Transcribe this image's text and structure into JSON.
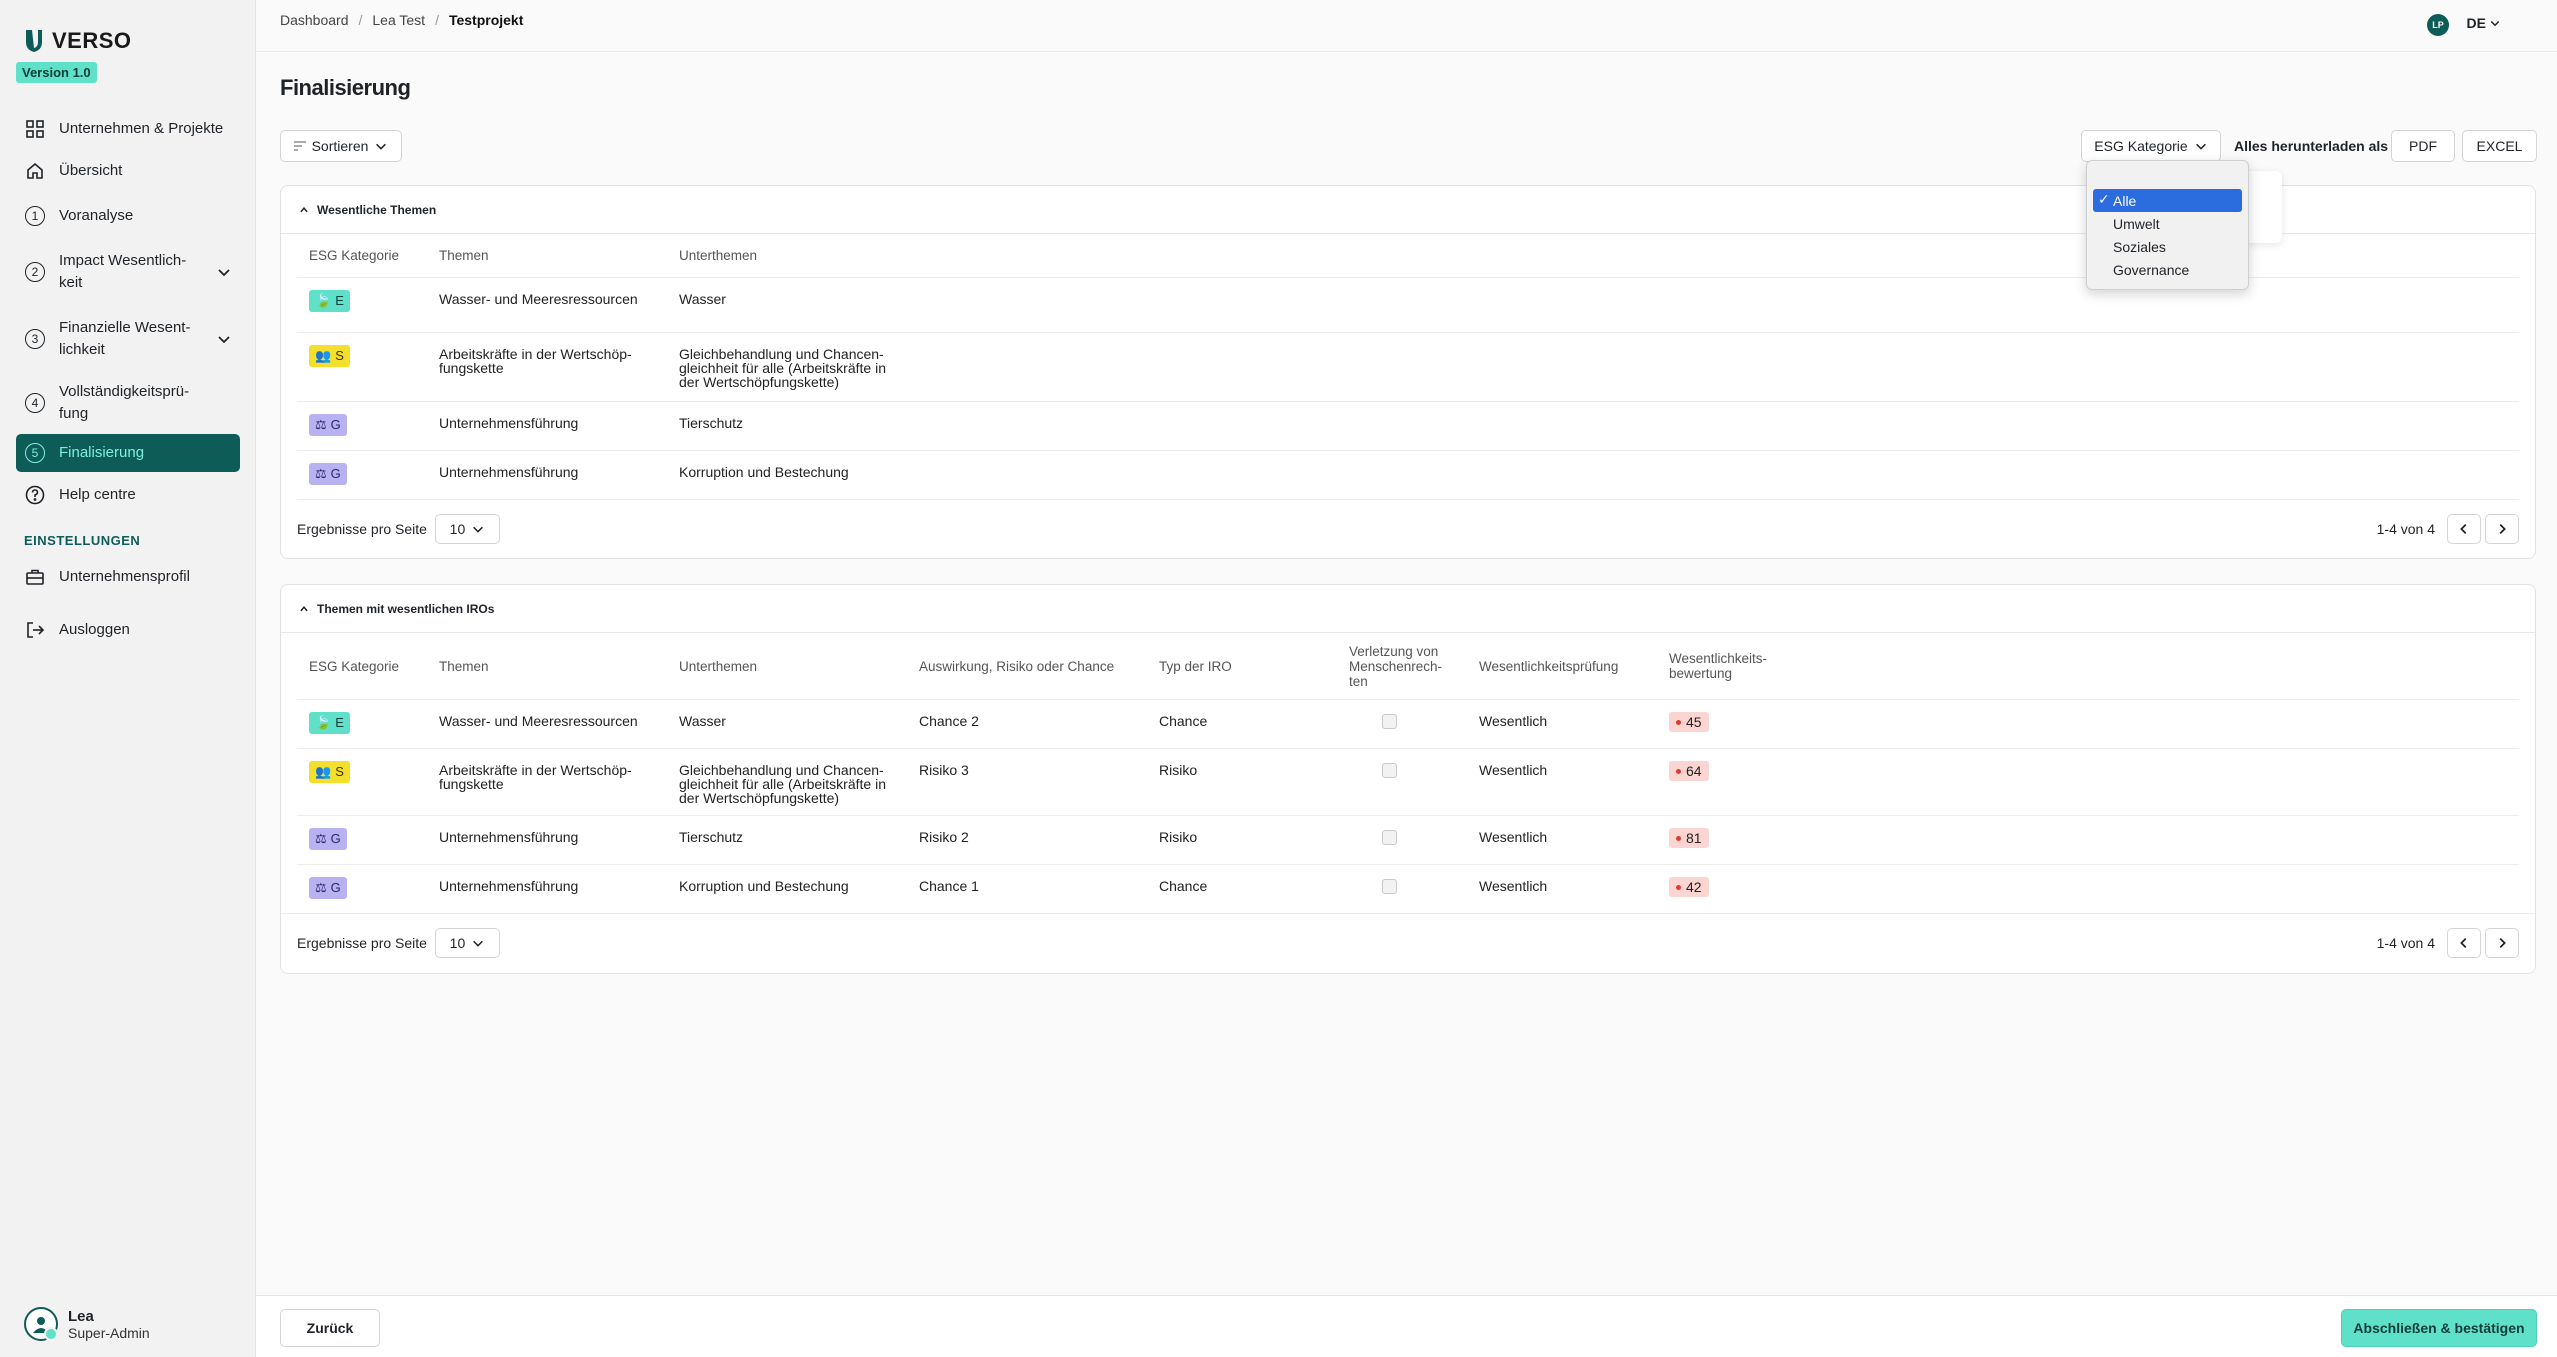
{
  "app": {
    "name": "VERSO",
    "version": "Version 1.0"
  },
  "sidebar": {
    "items": [
      {
        "label": "Unternehmen & Projekte",
        "icon": "grid-icon"
      },
      {
        "label": "Übersicht",
        "icon": "home-icon"
      },
      {
        "label": "Voranalyse",
        "icon": "step-1-icon",
        "num": "1"
      },
      {
        "label": "Impact Wesentlich-keit",
        "icon": "step-2-icon",
        "num": "2"
      },
      {
        "label": "Finanzielle Wesent-lichkeit",
        "icon": "step-3-icon",
        "num": "3"
      },
      {
        "label": "Vollständigkeitsprü-fung",
        "icon": "step-4-icon",
        "num": "4"
      },
      {
        "label": "Finalisierung",
        "icon": "step-5-icon",
        "num": "5"
      },
      {
        "label": "Help centre",
        "icon": "help-icon"
      }
    ],
    "settings_title": "EINSTELLUNGEN",
    "settings_items": [
      {
        "label": "Unternehmensprofil",
        "icon": "briefcase-icon"
      },
      {
        "label": "Ausloggen",
        "icon": "logout-icon"
      }
    ],
    "user": {
      "name": "Lea",
      "role": "Super-Admin"
    }
  },
  "topbar": {
    "breadcrumb": [
      "Dashboard",
      "Lea Test",
      "Testprojekt"
    ],
    "avatar_initials": "LP",
    "language": "DE"
  },
  "page": {
    "title": "Finalisierung",
    "sort_label": "Sortieren",
    "esg_filter_label": "ESG Kategorie",
    "download_label": "Alles herunterladen als",
    "pdf_label": "PDF",
    "excel_label": "EXCEL"
  },
  "dropdown": {
    "options": [
      "Alle",
      "Umwelt",
      "Soziales",
      "Governance"
    ],
    "selected": "Alle"
  },
  "table1": {
    "title": "Wesentliche Themen",
    "headers": [
      "ESG Kategorie",
      "Themen",
      "Unterthemen"
    ],
    "rows": [
      {
        "cat": "E",
        "topic": "Wasser- und Meeresressourcen",
        "sub": "Wasser"
      },
      {
        "cat": "S",
        "topic": "Arbeitskräfte in der Wertschöp-fungskette",
        "sub": "Gleichbehandlung und Chancen-gleichheit für alle (Arbeitskräfte in der Wertschöpfungskette)"
      },
      {
        "cat": "G",
        "topic": "Unternehmensführung",
        "sub": "Tierschutz"
      },
      {
        "cat": "G",
        "topic": "Unternehmensführung",
        "sub": "Korruption und Bestechung"
      }
    ],
    "per_page_label": "Ergebnisse pro Seite",
    "per_page_value": "10",
    "pager": "1-4 von 4"
  },
  "table2": {
    "title": "Themen mit wesentlichen IROs",
    "headers": [
      "ESG Kategorie",
      "Themen",
      "Unterthemen",
      "Auswirkung, Risiko oder Chance",
      "Typ der IRO",
      "Verletzung von Menschenrech-ten",
      "Wesentlichkeitsprüfung",
      "Wesentlichkeits-bewertung"
    ],
    "rows": [
      {
        "cat": "E",
        "topic": "Wasser- und Meeresressourcen",
        "sub": "Wasser",
        "iro": "Chance 2",
        "type": "Chance",
        "check": "Wesentlich",
        "score": "45"
      },
      {
        "cat": "S",
        "topic": "Arbeitskräfte in der Wertschöp-fungskette",
        "sub": "Gleichbehandlung und Chancen-gleichheit für alle (Arbeitskräfte in der Wertschöpfungskette)",
        "iro": "Risiko 3",
        "type": "Risiko",
        "check": "Wesentlich",
        "score": "64"
      },
      {
        "cat": "G",
        "topic": "Unternehmensführung",
        "sub": "Tierschutz",
        "iro": "Risiko 2",
        "type": "Risiko",
        "check": "Wesentlich",
        "score": "81"
      },
      {
        "cat": "G",
        "topic": "Unternehmensführung",
        "sub": "Korruption und Bestechung",
        "iro": "Chance 1",
        "type": "Chance",
        "check": "Wesentlich",
        "score": "42"
      }
    ],
    "per_page_label": "Ergebnisse pro Seite",
    "per_page_value": "10",
    "pager": "1-4 von 4"
  },
  "footer": {
    "back_label": "Zurück",
    "confirm_label": "Abschließen & bestätigen"
  },
  "colors": {
    "accent": "#0e5c58",
    "mint": "#5fe0c8",
    "social": "#f4e02b",
    "governance": "#b9b2f0",
    "score_bg": "#fbd5d2"
  }
}
